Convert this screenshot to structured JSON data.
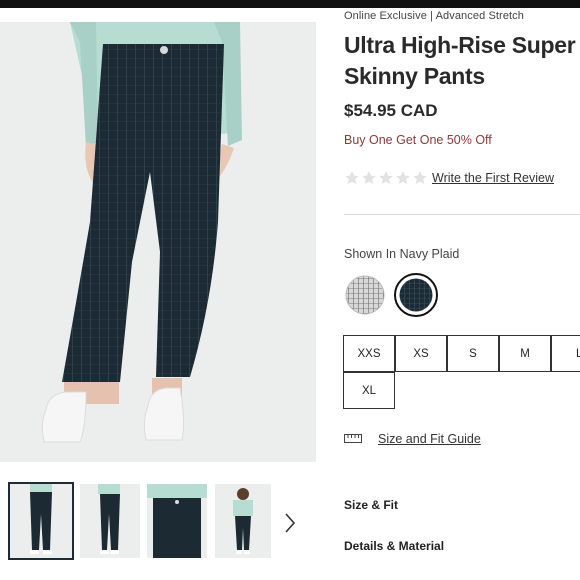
{
  "product": {
    "kicker": "Online Exclusive | Advanced Stretch",
    "title_line1": "Ultra High-Rise Super",
    "title_line2": "Skinny Pants",
    "price": "$54.95 CAD",
    "promo": "Buy One Get One 50% Off",
    "rating": 0,
    "rating_max": 5,
    "review_link": "Write the First Review"
  },
  "color": {
    "label": "Shown In Navy Plaid",
    "swatches": [
      {
        "name": "grey-plaid",
        "selected": false,
        "color": "#b8b8b8"
      },
      {
        "name": "navy-plaid",
        "selected": true,
        "color": "#1d2b36"
      }
    ]
  },
  "sizes": [
    "XXS",
    "XS",
    "S",
    "M",
    "L",
    "XL"
  ],
  "size_guide": "Size and Fit Guide",
  "accordions": [
    "Size & Fit",
    "Details & Material"
  ],
  "colors": {
    "pants": "#1c2a34",
    "sweater": "#b7ddd3",
    "promo": "#8c3a3a",
    "divider": "#e4d3d8"
  },
  "icons": {
    "thumb_next": "chevron-right-icon",
    "star": "star-icon",
    "guide": "ruler-icon"
  }
}
